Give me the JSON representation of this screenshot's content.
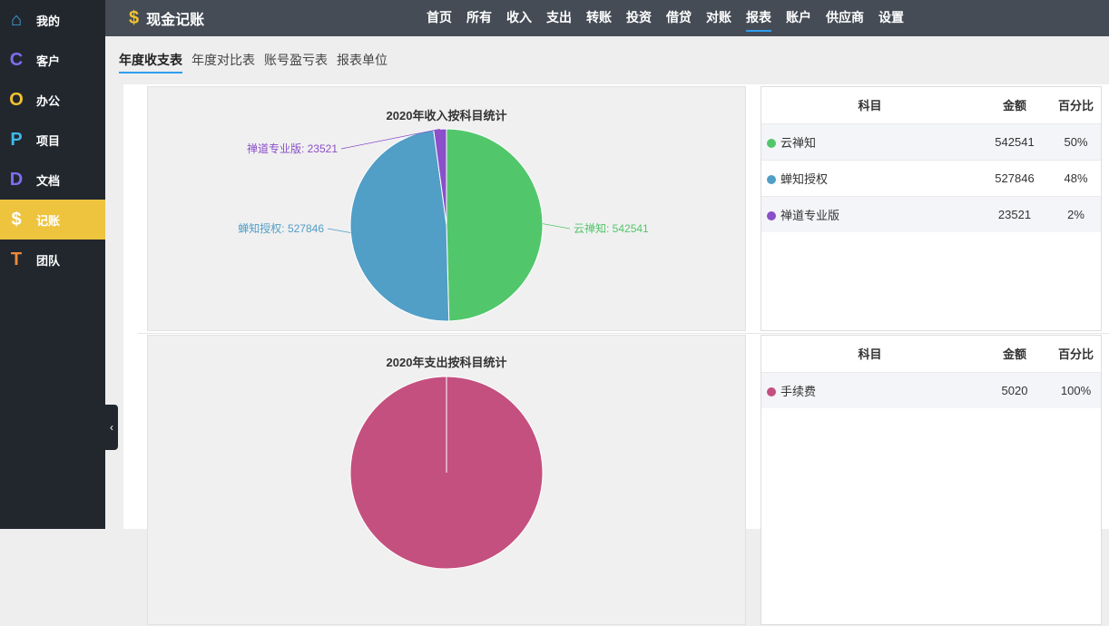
{
  "sidebar": {
    "items": [
      {
        "label": "我的",
        "icon": "home-icon",
        "glyph": "⌂",
        "color": "#3fa8e8"
      },
      {
        "label": "客户",
        "icon": "c-icon",
        "glyph": "C",
        "color": "#7a6ff0"
      },
      {
        "label": "办公",
        "icon": "o-icon",
        "glyph": "O",
        "color": "#f2c230"
      },
      {
        "label": "项目",
        "icon": "p-icon",
        "glyph": "P",
        "color": "#3fb8e8"
      },
      {
        "label": "文档",
        "icon": "d-icon",
        "glyph": "D",
        "color": "#7a6ff0"
      },
      {
        "label": "记账",
        "icon": "dollar-icon",
        "glyph": "$",
        "color": "#ffffff"
      },
      {
        "label": "团队",
        "icon": "t-icon",
        "glyph": "T",
        "color": "#f08a3a"
      }
    ],
    "collapse": "‹"
  },
  "header": {
    "title": "现金记账",
    "logo_glyph": "$",
    "nav": [
      "首页",
      "所有",
      "收入",
      "支出",
      "转账",
      "投资",
      "借贷",
      "对账",
      "报表",
      "账户",
      "供应商",
      "设置"
    ],
    "active_nav": 8
  },
  "subtabs": [
    "年度收支表",
    "年度对比表",
    "账号盈亏表",
    "报表单位"
  ],
  "columns": {
    "subject": "科目",
    "amount": "金额",
    "percent": "百分比"
  },
  "income": {
    "title": "2020年收入按科目统计",
    "rows": [
      {
        "name": "云禅知",
        "amount": 542541,
        "percent": "50%",
        "color": "#52c66b",
        "label": "云禅知: 542541"
      },
      {
        "name": "蝉知授权",
        "amount": 527846,
        "percent": "48%",
        "color": "#519ec7",
        "label": "蝉知授权: 527846"
      },
      {
        "name": "禅道专业版",
        "amount": 23521,
        "percent": "2%",
        "color": "#8a4fc9",
        "label": "禅道专业版: 23521"
      }
    ]
  },
  "expense": {
    "title": "2020年支出按科目统计",
    "rows": [
      {
        "name": "手续费",
        "amount": 5020,
        "percent": "100%",
        "color": "#c4507f"
      }
    ]
  }
}
